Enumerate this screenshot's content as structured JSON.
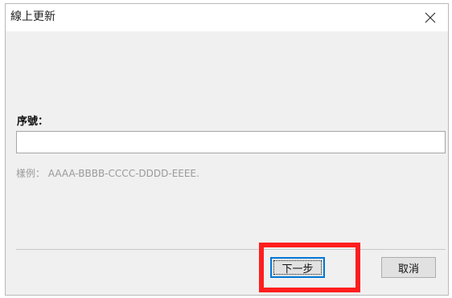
{
  "window": {
    "title": "線上更新",
    "close_symbol": "×"
  },
  "form": {
    "serial_label": "序號：",
    "serial_value": "",
    "serial_placeholder": "",
    "hint": "樣例： AAAA-BBBB-CCCC-DDDD-EEEE."
  },
  "buttons": {
    "next_label": "下一步",
    "cancel_label": "取消"
  },
  "annotation": {
    "highlight_color": "#ff1e1e",
    "highlight_target": "next-button"
  },
  "icons": {
    "close": "close-icon"
  }
}
